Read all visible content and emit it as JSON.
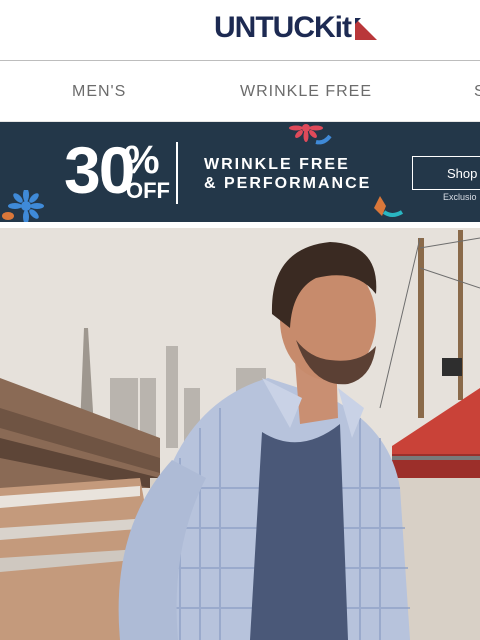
{
  "header": {
    "logo_text": "UNTUCKit",
    "brand_color": "#1d2a52",
    "accent_color": "#b9373a"
  },
  "nav": {
    "items": [
      "MEN'S",
      "WRINKLE FREE",
      "S"
    ]
  },
  "banner": {
    "number": "30",
    "percent": "%",
    "off": "OFF",
    "line1": "WRINKLE FREE",
    "line2": "& PERFORMANCE",
    "shop_label": "Shop",
    "exclusions": "Exclusio",
    "background": "#233749"
  },
  "hero": {
    "description": "hero-photo"
  }
}
